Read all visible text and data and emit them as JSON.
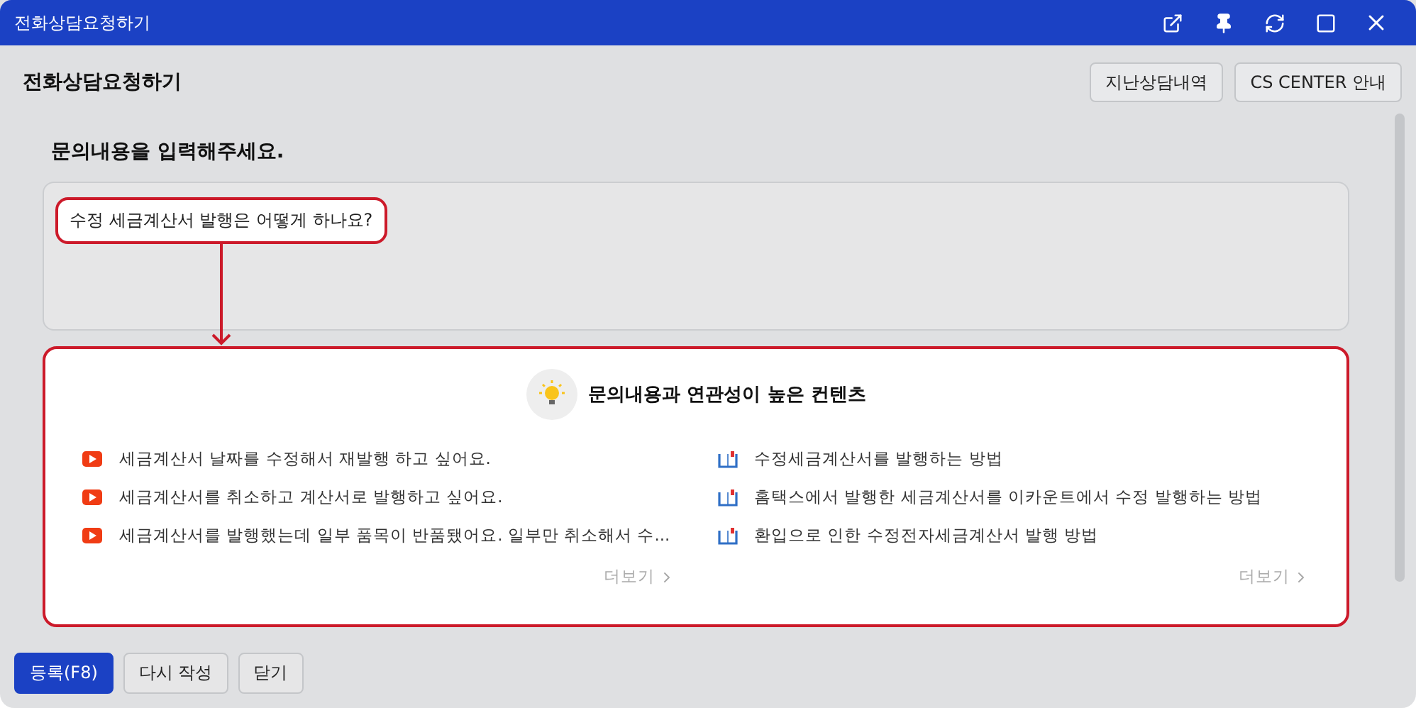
{
  "window": {
    "title": "전화상담요청하기"
  },
  "header": {
    "title": "전화상담요청하기",
    "buttons": [
      "지난상담내역",
      "CS CENTER 안내"
    ]
  },
  "prompt": "문의내용을 입력해주세요.",
  "question": {
    "value": "수정 세금계산서 발행은 어떻게 하나요?"
  },
  "related": {
    "title": "문의내용과 연관성이 높은 컨텐츠",
    "columns": [
      {
        "kind": "video",
        "more": "더보기",
        "items": [
          "세금계산서 날짜를 수정해서 재발행 하고 싶어요.",
          "세금계산서를 취소하고 계산서로 발행하고 싶어요.",
          "세금계산서를 발행했는데 일부 품목이 반품됐어요. 일부만 취소해서 수..."
        ]
      },
      {
        "kind": "manual",
        "more": "더보기",
        "items": [
          "수정세금계산서를 발행하는 방법",
          "홈택스에서 발행한 세금계산서를 이카운트에서 수정 발행하는 방법",
          "환입으로 인한 수정전자세금계산서 발행 방법"
        ]
      }
    ]
  },
  "footer": [
    {
      "label": "등록(F8)",
      "primary": true
    },
    {
      "label": "다시 작성",
      "primary": false
    },
    {
      "label": "닫기",
      "primary": false
    }
  ]
}
